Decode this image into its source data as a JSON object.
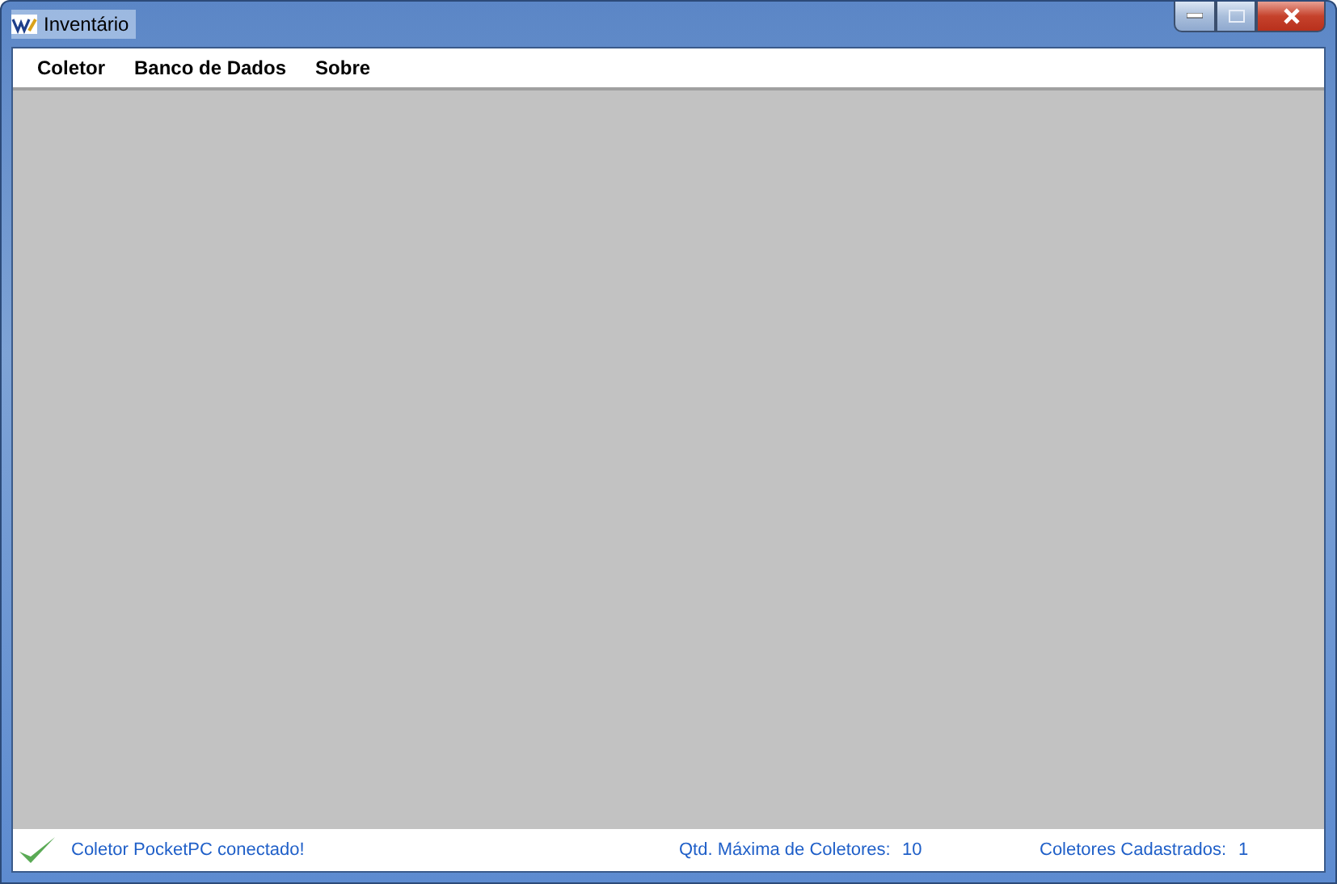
{
  "window": {
    "title": "Inventário"
  },
  "menu": [
    {
      "label": "Coletor"
    },
    {
      "label": "Banco de Dados"
    },
    {
      "label": "Sobre"
    }
  ],
  "status_bar": {
    "connected": true,
    "message": "Coletor PocketPC conectado!",
    "fields": [
      {
        "label": "Qtd. Máxima de Coletores:",
        "value": "10"
      },
      {
        "label": "Coletores Cadastrados:",
        "value": "1"
      }
    ]
  }
}
